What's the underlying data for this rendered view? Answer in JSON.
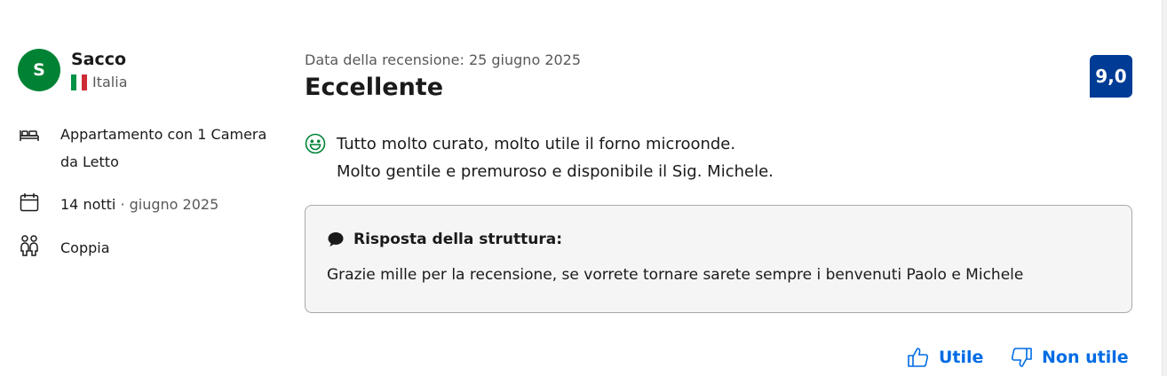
{
  "reviewer": {
    "initial": "S",
    "name": "Sacco",
    "country": "Italia",
    "avatar_color": "#008234"
  },
  "stay": {
    "room": "Appartamento con 1 Camera da Letto",
    "nights": "14 notti",
    "separator": " · ",
    "month": "giugno 2025",
    "traveler_type": "Coppia"
  },
  "review": {
    "date": "Data della recensione: 25 giugno 2025",
    "title": "Eccellente",
    "score": "9,0",
    "score_color": "#003b95",
    "positive_line1": "Tutto molto curato, molto utile il forno microonde.",
    "positive_line2": "Molto gentile e premuroso e disponibile il Sig. Michele."
  },
  "response": {
    "heading": "Risposta della struttura:",
    "text": "Grazie mille per la recensione, se vorrete tornare sarete sempre i benvenuti Paolo e Michele"
  },
  "actions": {
    "helpful": "Utile",
    "not_helpful": "Non utile",
    "link_color": "#006ce4"
  },
  "icons": {
    "bed": "bed-icon",
    "calendar": "calendar-icon",
    "couple": "couple-icon",
    "smile": "smile-icon",
    "chat": "chat-bubble-icon",
    "thumbs_up": "thumbs-up-icon",
    "thumbs_down": "thumbs-down-icon",
    "flag": "italy-flag-icon"
  }
}
